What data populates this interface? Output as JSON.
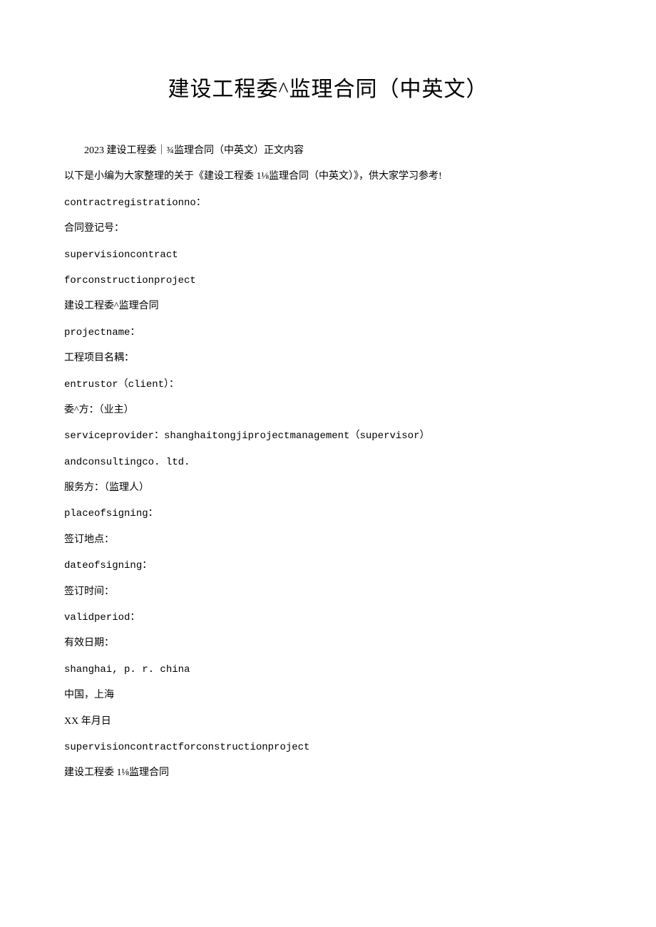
{
  "title": "建设工程委^监理合同（中英文）",
  "intro": "2023 建设工程委｜¾监理合同（中英文）正文内容",
  "lines": [
    "以下是小编为大家整理的关于《建设工程委 1⅛监理合同（中英文）》，供大家学习参考!",
    "contractregistrationno：",
    "合同登记号：",
    "supervisioncontract",
    "forconstructionproject",
    "建设工程委^监理合同",
    "projectname：",
    "工程项目名耦：",
    "entrustor（client）：",
    "委^方：（业主）",
    "serviceprovider：shanghaitongjiprojectmanagement（supervisor）",
    "andconsultingco. ltd.",
    "服务方：（监理人）",
    "placeofsigning：",
    "签订地点：",
    "dateofsigning：",
    "签订时间：",
    "validperiod：",
    "有效日期：",
    "shanghai, p. r. china",
    "中国，上海",
    "XX 年月日",
    "supervisioncontractforconstructionproject",
    "建设工程委 1⅛监理合同"
  ]
}
